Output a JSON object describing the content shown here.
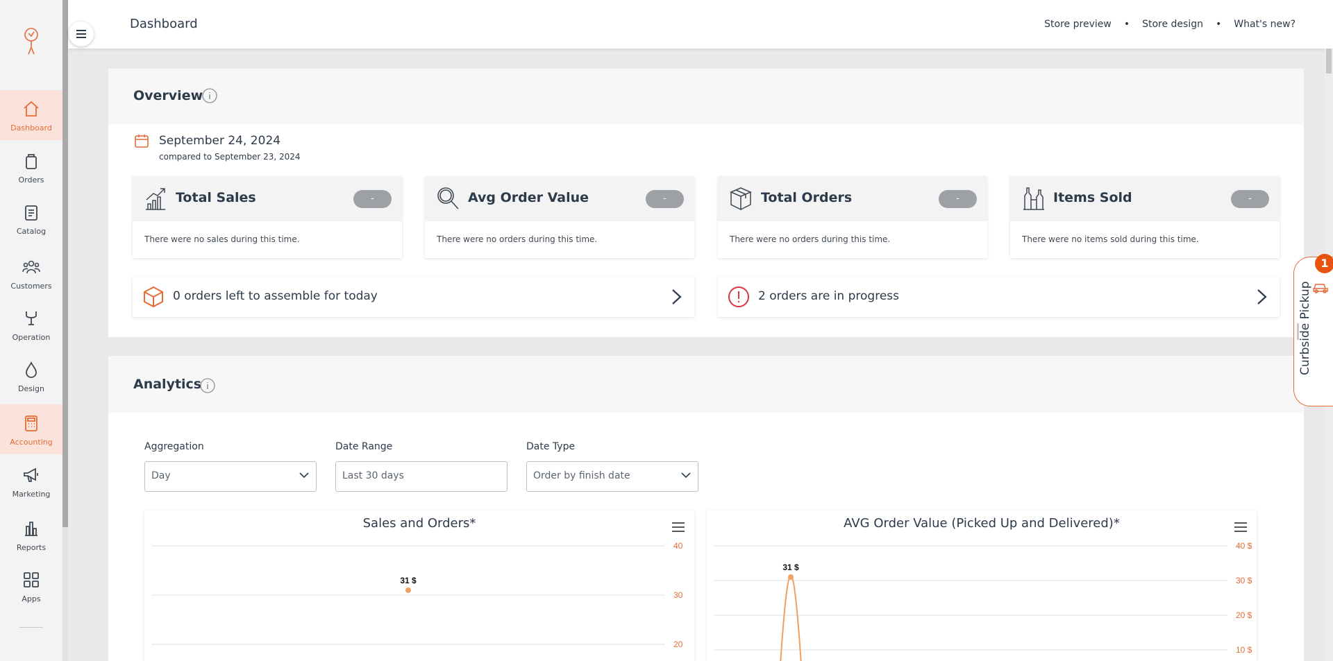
{
  "sidebar": {
    "items": [
      {
        "label": "Dashboard",
        "icon": "home-icon"
      },
      {
        "label": "Orders",
        "icon": "bag-icon"
      },
      {
        "label": "Catalog",
        "icon": "clipboard-icon"
      },
      {
        "label": "Customers",
        "icon": "users-icon"
      },
      {
        "label": "Operation",
        "icon": "operation-icon"
      },
      {
        "label": "Design",
        "icon": "drops-icon"
      },
      {
        "label": "Accounting",
        "icon": "calculator-icon"
      },
      {
        "label": "Marketing",
        "icon": "megaphone-icon"
      },
      {
        "label": "Reports",
        "icon": "bar-chart-icon"
      },
      {
        "label": "Apps",
        "icon": "apps-grid-icon"
      }
    ],
    "active": [
      "Dashboard",
      "Accounting"
    ]
  },
  "header": {
    "title": "Dashboard",
    "links": [
      "Store preview",
      "Store design",
      "What's new?"
    ],
    "separator": "•"
  },
  "overview": {
    "title": "Overview",
    "date": "September 24, 2024",
    "compared": "compared to September 23, 2024",
    "cards": [
      {
        "title": "Total Sales",
        "badge": "-",
        "text": "There were no sales during this time.",
        "icon": "trend-chart-icon"
      },
      {
        "title": "Avg Order Value",
        "badge": "-",
        "text": "There were no orders during this time.",
        "icon": "magnifier-icon"
      },
      {
        "title": "Total Orders",
        "badge": "-",
        "text": "There were no orders during this time.",
        "icon": "box-icon"
      },
      {
        "title": "Items Sold",
        "badge": "-",
        "text": "There were no items sold during this time.",
        "icon": "bottles-icon"
      }
    ],
    "tasks": [
      {
        "text": "0 orders left to assemble for today",
        "icon": "package-icon"
      },
      {
        "text": "2 orders are in progress",
        "icon": "alert-icon"
      }
    ]
  },
  "analytics": {
    "title": "Analytics",
    "filters": {
      "aggregation": {
        "label": "Aggregation",
        "value": "Day"
      },
      "date_range": {
        "label": "Date Range",
        "value": "Last 30 days"
      },
      "date_type": {
        "label": "Date Type",
        "value": "Order by finish date"
      }
    }
  },
  "curbside": {
    "label": "Curbside Pickup",
    "count": "1"
  },
  "colors": {
    "accent": "#e46c37",
    "active_bg": "#fbe3db",
    "alert": "#d9363e",
    "badge_gray": "#9da1a6",
    "text_dark": "#2d3a4a"
  },
  "chart_data": [
    {
      "type": "line",
      "title": "Sales and Orders*",
      "y_ticks": [
        "40",
        "30",
        "20"
      ],
      "ylim": [
        20,
        40
      ],
      "series": [
        {
          "points": [
            {
              "x": 0.5,
              "y": 31,
              "label": "31 $"
            }
          ]
        }
      ],
      "grid": true
    },
    {
      "type": "line",
      "title": "AVG Order Value (Picked Up and Delivered)*",
      "y_ticks": [
        "40 $",
        "30 $",
        "20 $",
        "10 $"
      ],
      "ylim": [
        10,
        40
      ],
      "series": [
        {
          "points": [
            {
              "x": 0.15,
              "y": 31,
              "label": "31 $"
            }
          ]
        }
      ],
      "grid": true
    }
  ]
}
